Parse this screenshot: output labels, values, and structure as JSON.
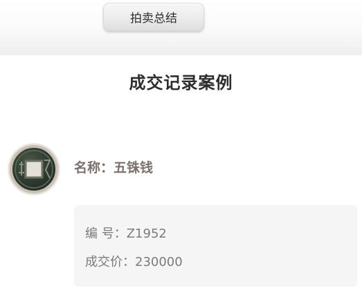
{
  "toolbar": {
    "summary_label": "拍卖总结"
  },
  "section": {
    "title": "成交记录案例"
  },
  "item": {
    "name": "名称：五铢钱",
    "number_label": "编 号：Z1952",
    "price_label": "成交价：230000"
  },
  "icons": {
    "coin": "wuzhu-coin-icon"
  }
}
